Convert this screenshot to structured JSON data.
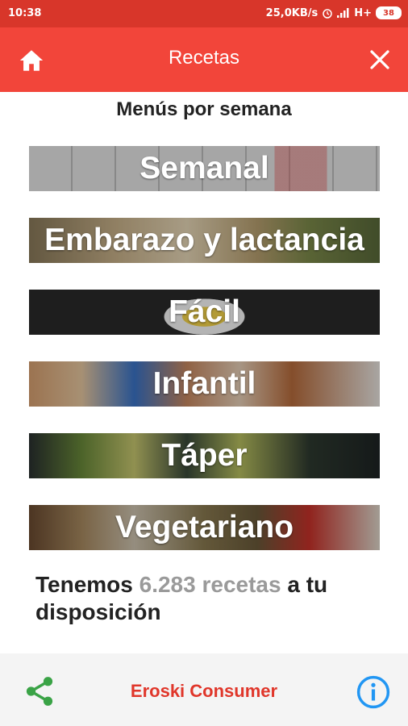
{
  "status_bar": {
    "time": "10:38",
    "network_speed": "25,0KB/s",
    "network_type": "H+",
    "battery": "38"
  },
  "app_bar": {
    "title": "Recetas",
    "home_icon": "home-icon",
    "close_icon": "close-icon"
  },
  "subtitle": "Menús por semana",
  "menus": [
    {
      "label": "Semanal"
    },
    {
      "label": "Embarazo y lactancia"
    },
    {
      "label": "Fácil"
    },
    {
      "label": "Infantil"
    },
    {
      "label": "Táper"
    },
    {
      "label": "Vegetariano"
    }
  ],
  "info": {
    "prefix": "Tenemos ",
    "count": "6.283 recetas",
    "suffix": " a tu disposición"
  },
  "bottom_bar": {
    "brand": "Eroski Consumer",
    "share_icon": "share-icon",
    "info_icon": "info-icon"
  },
  "colors": {
    "status_bar": "#d8362a",
    "app_bar": "#f2453a",
    "brand": "#e0362a",
    "share": "#3aa346",
    "info": "#2196f3"
  }
}
